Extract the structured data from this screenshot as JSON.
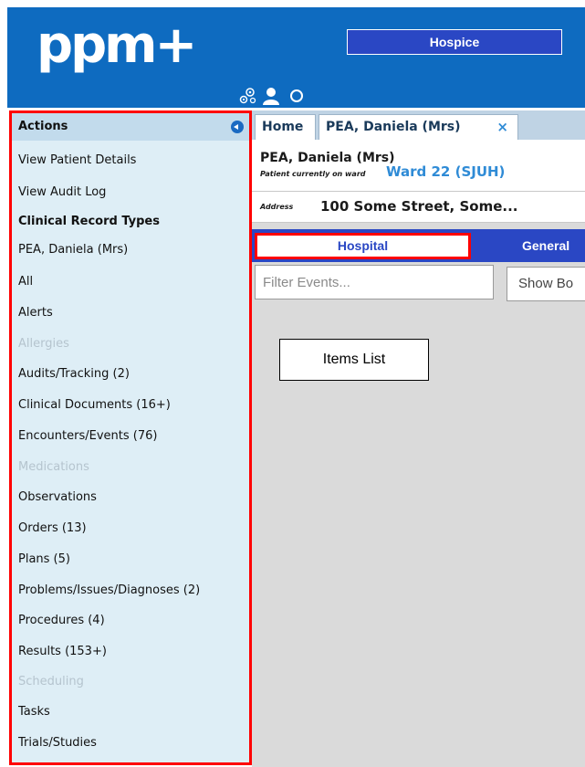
{
  "header": {
    "logo_text": "ppm+",
    "site_button_label": "Hospice",
    "icons": [
      "workflow-gears-icon",
      "user-icon",
      "refresh-icon"
    ],
    "background_color": "#0e6bc0"
  },
  "sidebar": {
    "header": "Actions",
    "items": [
      {
        "label": "View Patient Details",
        "style": "normal"
      },
      {
        "label": "View Audit Log",
        "style": "normal"
      },
      {
        "label": "Clinical Record Types",
        "style": "heading"
      },
      {
        "label": "PEA, Daniela (Mrs)",
        "style": "normal"
      },
      {
        "label": "All",
        "style": "normal"
      },
      {
        "label": "Alerts",
        "style": "normal"
      },
      {
        "label": "Allergies",
        "style": "disabled"
      },
      {
        "label": "Audits/Tracking (2)",
        "style": "normal"
      },
      {
        "label": "Clinical Documents (16+)",
        "style": "normal"
      },
      {
        "label": "Encounters/Events (76)",
        "style": "normal"
      },
      {
        "label": "Medications",
        "style": "disabled"
      },
      {
        "label": "Observations",
        "style": "normal"
      },
      {
        "label": "Orders (13)",
        "style": "normal"
      },
      {
        "label": "Plans (5)",
        "style": "normal"
      },
      {
        "label": "Problems/Issues/Diagnoses (2)",
        "style": "normal"
      },
      {
        "label": "Procedures (4)",
        "style": "normal"
      },
      {
        "label": "Results (153+)",
        "style": "normal"
      },
      {
        "label": "Scheduling",
        "style": "disabled"
      },
      {
        "label": "Tasks",
        "style": "normal"
      },
      {
        "label": "Trials/Studies",
        "style": "normal"
      }
    ]
  },
  "tabs": {
    "home_label": "Home",
    "patient_tab_label": "PEA, Daniela (Mrs)",
    "close_glyph": "×"
  },
  "patient": {
    "name": "PEA, Daniela (Mrs)",
    "ward_label": "Patient currently on ward",
    "ward_value": "Ward 22 (SJUH)",
    "address_label": "Address",
    "address_value": "100 Some Street, Some..."
  },
  "view_tabs": {
    "hospital": "Hospital",
    "general": "General"
  },
  "filter": {
    "placeholder": "Filter Events...",
    "show_button": "Show Bo"
  },
  "annotation": {
    "callout": "Items List",
    "highlight_color": "#ff0000"
  }
}
